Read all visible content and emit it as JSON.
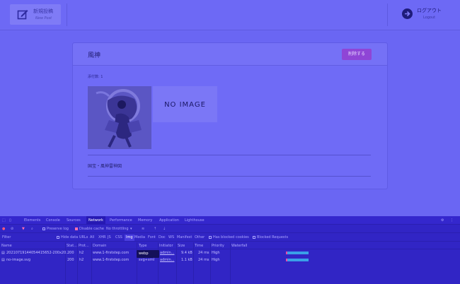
{
  "header": {
    "new_post_label": "新規投稿",
    "new_post_sub": "New Post",
    "logout_label": "ログアウト",
    "logout_sub": "Logout"
  },
  "post": {
    "title": "風神",
    "delete_label": "削除する",
    "count_label": "添付数: 1",
    "no_image_label": "NO IMAGE",
    "caption": "国宝・風神雷神図"
  },
  "devtools": {
    "tabs": [
      "Elements",
      "Console",
      "Sources",
      "Network",
      "Performance",
      "Memory",
      "Application",
      "Lighthouse"
    ],
    "active_tab": "Network",
    "toolbar": {
      "preserve_log": "Preserve log",
      "disable_cache": "Disable cache",
      "throttling": "No throttling"
    },
    "filter": {
      "placeholder": "Filter",
      "hide_data_urls": "Hide data URLs",
      "types": [
        "All",
        "XHR",
        "JS",
        "CSS",
        "Img",
        "Media",
        "Font",
        "Doc",
        "WS",
        "Manifest",
        "Other"
      ],
      "blocked_cookies": "Has blocked cookies",
      "blocked_requests": "Blocked Requests"
    },
    "columns": [
      "Name",
      "Stat...",
      "Prot...",
      "Domain",
      "Type",
      "Initiator",
      "Size",
      "Time",
      "Priority",
      "Waterfall"
    ],
    "rows": [
      {
        "name": "20210719144054415652-200x20...",
        "status": "200",
        "protocol": "h2",
        "domain": "www.1-firststep.com",
        "type": "webp",
        "initiator": "admin...",
        "size": "9.4 kB",
        "time": "24 ms",
        "priority": "High"
      },
      {
        "name": "no-image.svg",
        "status": "200",
        "protocol": "h2",
        "domain": "www.1-firststep.com",
        "type": "svg+xml",
        "initiator": "admin...",
        "size": "1.1 kB",
        "time": "24 ms",
        "priority": "High"
      }
    ],
    "tooltip": "webp"
  }
}
